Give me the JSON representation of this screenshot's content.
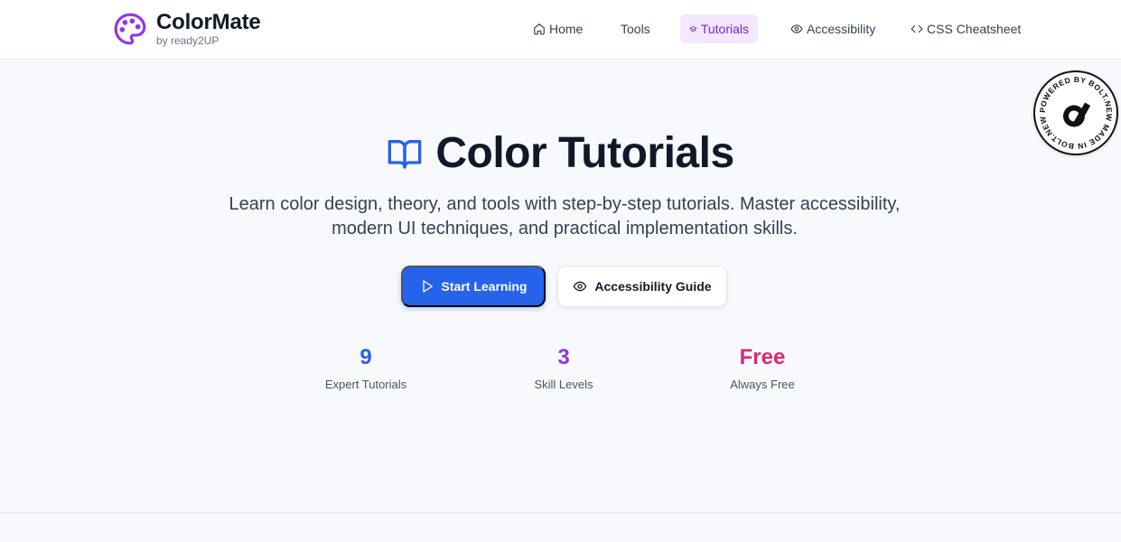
{
  "brand": {
    "name": "ColorMate",
    "subtitle": "by ready2UP",
    "icon": "palette-icon",
    "color": "#9333ea"
  },
  "nav": [
    {
      "label": "Home",
      "icon": "home-icon"
    },
    {
      "label": "Tools",
      "icon": ""
    },
    {
      "label": "Tutorials",
      "icon": "graduation-cap-icon",
      "active": true
    },
    {
      "label": "Accessibility",
      "icon": "eye-icon"
    },
    {
      "label": "CSS Cheatsheet",
      "icon": "code-icon"
    }
  ],
  "badge": {
    "text": "POWERED BY BOLT.NEW MADE IN BOLT.NEW",
    "icon": "bolt-logo-icon"
  },
  "hero": {
    "icon": "book-open-icon",
    "title": "Color Tutorials",
    "description_line1": "Learn color design, theory, and tools with step-by-step tutorials. Master accessibility,",
    "description_line2": "modern UI techniques, and practical implementation skills."
  },
  "buttons": {
    "primary": {
      "label": "Start Learning",
      "icon": "play-icon"
    },
    "secondary": {
      "label": "Accessibility Guide",
      "icon": "eye-icon"
    }
  },
  "stats": [
    {
      "value": "9",
      "label": "Expert Tutorials",
      "color": "#2563eb"
    },
    {
      "value": "3",
      "label": "Skill Levels",
      "color": "#9333ea"
    },
    {
      "value": "Free",
      "label": "Always Free",
      "color": "#db2777"
    }
  ]
}
